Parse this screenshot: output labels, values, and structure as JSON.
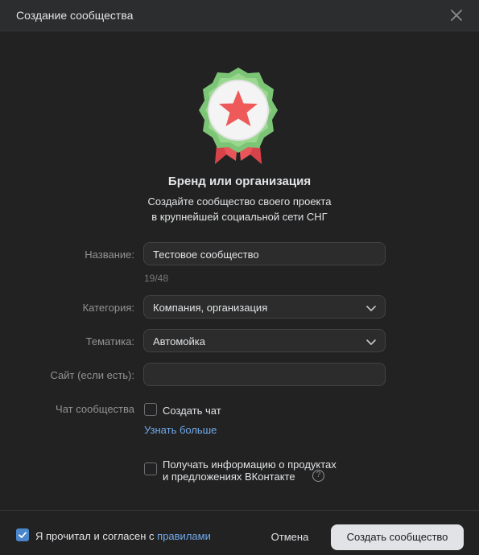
{
  "header": {
    "title": "Создание сообщества"
  },
  "hero": {
    "title": "Бренд или организация",
    "subtitle_line1": "Создайте сообщество своего проекта",
    "subtitle_line2": "в крупнейшей социальной сети СНГ"
  },
  "form": {
    "name": {
      "label": "Название:",
      "value": "Тестовое сообщество",
      "counter": "19/48"
    },
    "category": {
      "label": "Категория:",
      "value": "Компания, организация"
    },
    "topic": {
      "label": "Тематика:",
      "value": "Автомойка"
    },
    "site": {
      "label": "Сайт (если есть):",
      "value": ""
    },
    "chat": {
      "label": "Чат сообщества",
      "checkbox_label": "Создать чат",
      "checked": false,
      "learn_more": "Узнать больше"
    },
    "news": {
      "line1": "Получать информацию о продуктах",
      "line2": "и предложениях ВКонтакте",
      "checked": false,
      "help": "?"
    }
  },
  "footer": {
    "agree_prefix": "Я прочитал и согласен с",
    "agree_link": "правилами",
    "agree_checked": true,
    "cancel_label": "Отмена",
    "create_label": "Создать сообщество"
  },
  "colors": {
    "accent": "#4986cc",
    "link": "#71aaeb",
    "background": "#222222",
    "badge_green": "#74c46a",
    "badge_red": "#f05c5c"
  }
}
